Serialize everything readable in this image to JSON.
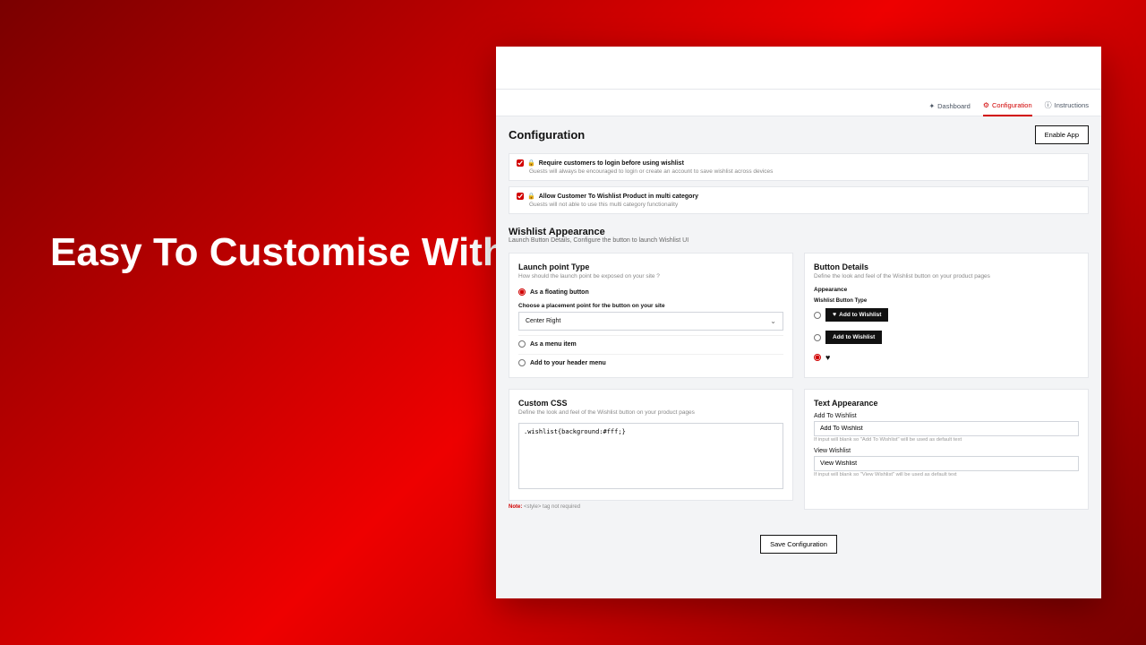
{
  "hero": "Easy To Customise With Custom CSS",
  "nav": {
    "dashboard": "Dashboard",
    "configuration": "Configuration",
    "instructions": "Instructions"
  },
  "header": {
    "title": "Configuration",
    "enable_btn": "Enable App"
  },
  "opts": {
    "login": {
      "label": "Require customers to login before using wishlist",
      "sub": "Guests will always be encouraged to login or create an account to save wishlist across devices"
    },
    "multi": {
      "label": "Allow Customer To Wishlist Product in multi category",
      "sub": "Guests will not able to use this multi category functionality"
    }
  },
  "appearance": {
    "title": "Wishlist Appearance",
    "sub": "Launch Button Details, Configure the button to launch Wishlist UI"
  },
  "launch": {
    "title": "Launch point Type",
    "sub": "How should the launch point be exposed on your site ?",
    "floating": "As a floating button",
    "place_label": "Choose a placement point for the button on your site",
    "selected": "Center Right",
    "menu": "As a menu item",
    "header": "Add to your header menu"
  },
  "details": {
    "title": "Button Details",
    "sub": "Define the look and feel of the Wishlist button on your product pages",
    "appearance_label": "Appearance",
    "type_label": "Wishlist Button Type",
    "opt1": "Add to Wishlist",
    "opt2": "Add to Wishlist"
  },
  "css": {
    "title": "Custom CSS",
    "sub": "Define the look and feel of the Wishlist button on your product pages",
    "value": ".wishlist{background:#fff;}",
    "note_prefix": "Note:",
    "note_text": " <style> tag not required"
  },
  "text": {
    "title": "Text Appearance",
    "add_label": "Add To Wishlist",
    "add_value": "Add To Wishlist",
    "add_hint": "If input will blank so \"Add To Wishlist\" will be used as default text",
    "view_label": "View Wishlist",
    "view_value": "View Wishlist",
    "view_hint": "If input will blank so \"View Wishlist\" will be used as default text"
  },
  "save_btn": "Save Configuration"
}
